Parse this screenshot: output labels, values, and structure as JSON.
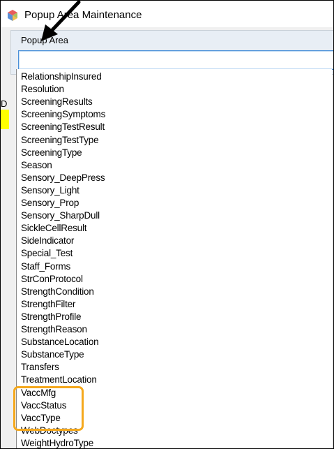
{
  "window": {
    "title": "Popup Area Maintenance",
    "icon": "app-cube-icon"
  },
  "group": {
    "label": "Popup Area",
    "input_value": ""
  },
  "background": {
    "partial_label": "D"
  },
  "dropdown": {
    "items": [
      "RelationshipInsured",
      "Resolution",
      "ScreeningResults",
      "ScreeningSymptoms",
      "ScreeningTestResult",
      "ScreeningTestType",
      "ScreeningType",
      "Season",
      "Sensory_DeepPress",
      "Sensory_Light",
      "Sensory_Prop",
      "Sensory_SharpDull",
      "SickleCellResult",
      "SideIndicator",
      "Special_Test",
      "Staff_Forms",
      "StrConProtocol",
      "StrengthCondition",
      "StrengthFilter",
      "StrengthProfile",
      "StrengthReason",
      "SubstanceLocation",
      "SubstanceType",
      "Transfers",
      "TreatmentLocation",
      "VaccMfg",
      "VaccStatus",
      "VaccType",
      "WebDoctypes",
      "WeightHydroType"
    ],
    "highlighted_items": [
      "VaccMfg",
      "VaccStatus",
      "VaccType"
    ]
  },
  "colors": {
    "highlight_box": "#f5a81c",
    "annotation_arrow": "#000000",
    "combo_focus_border": "#4a90d9"
  }
}
